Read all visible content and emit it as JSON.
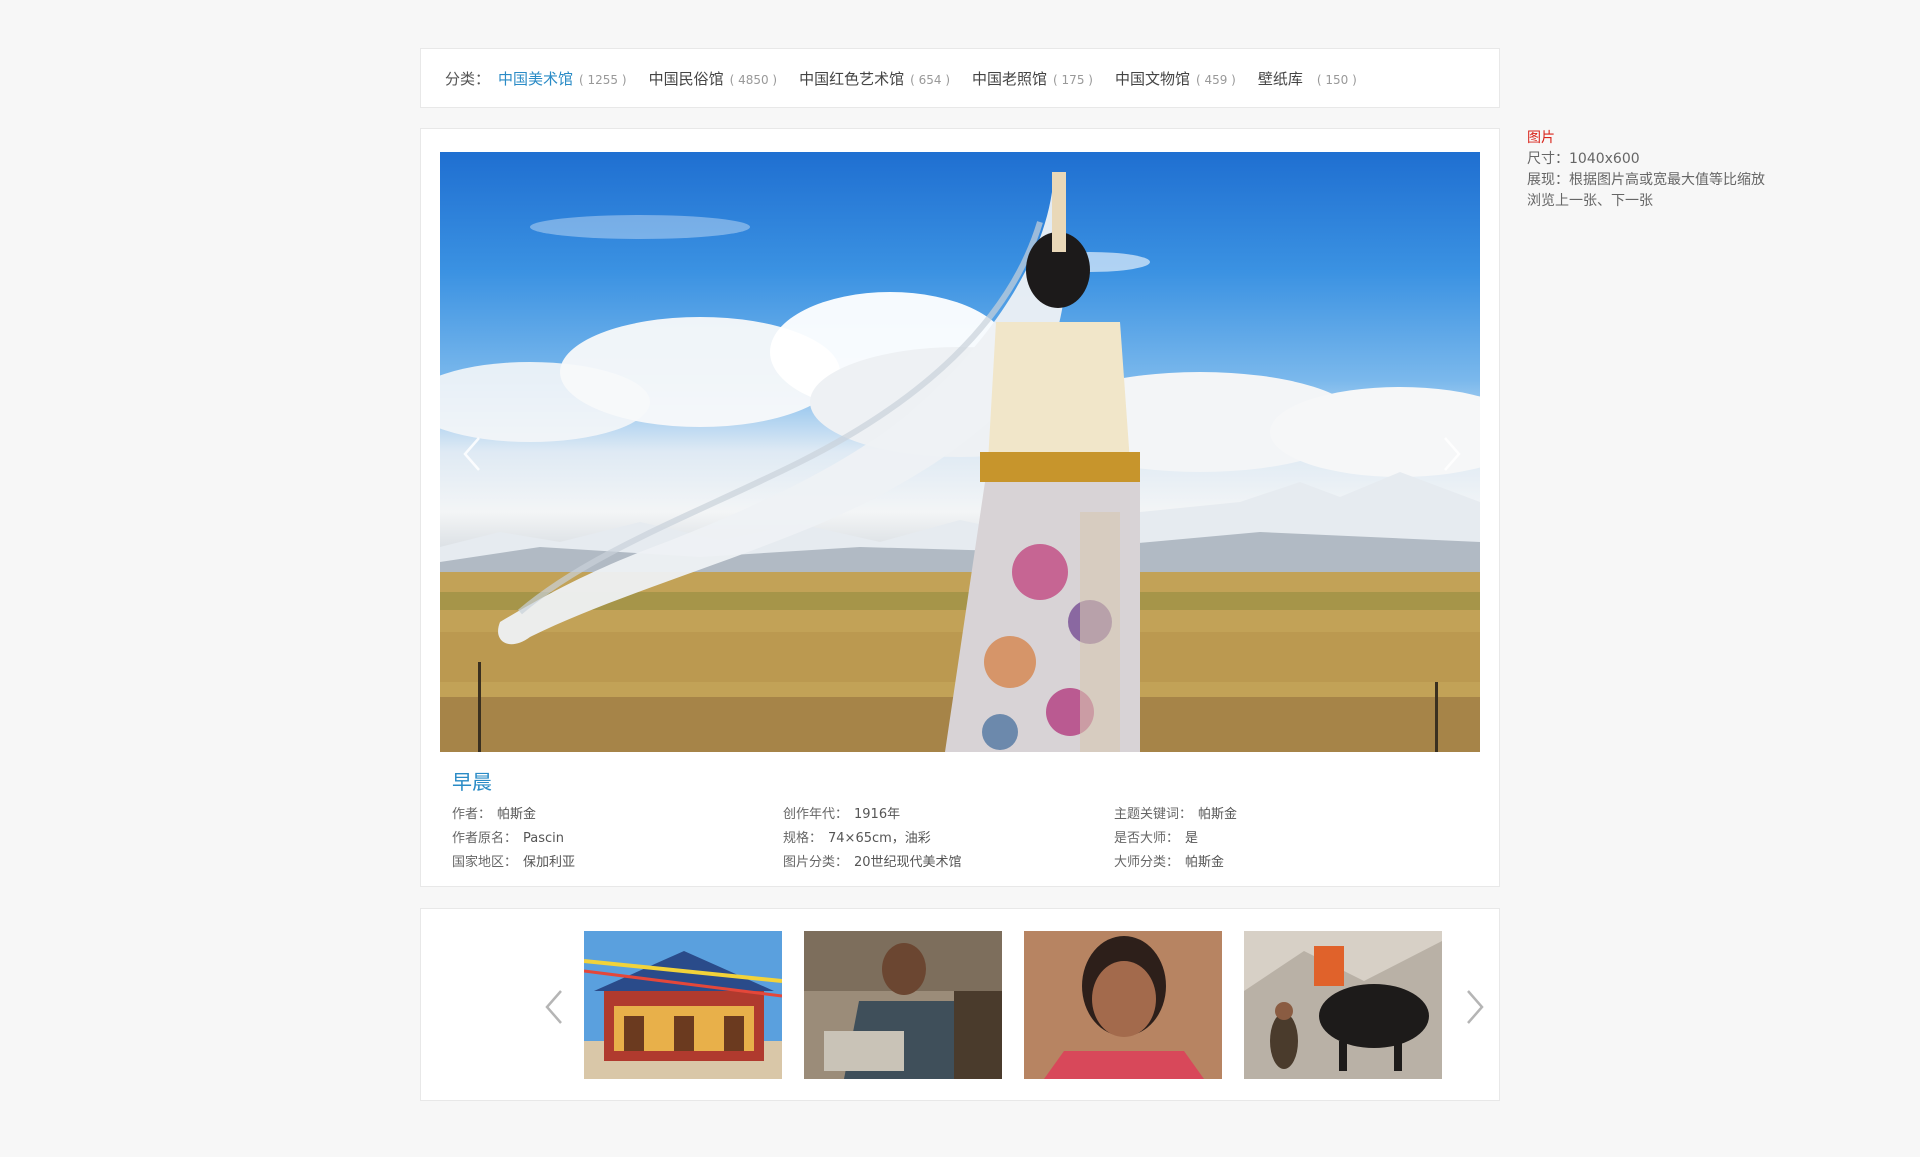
{
  "categories": {
    "label": "分类：",
    "items": [
      {
        "name": "中国美术馆",
        "count": "( 1255 )",
        "active": true
      },
      {
        "name": "中国民俗馆",
        "count": "( 4850 )"
      },
      {
        "name": "中国红色艺术馆",
        "count": "( 654 )"
      },
      {
        "name": "中国老照馆",
        "count": "( 175 )"
      },
      {
        "name": "中国文物馆",
        "count": "( 459 )"
      },
      {
        "name": "壁纸库",
        "count": "( 150 )"
      }
    ]
  },
  "artwork": {
    "title": "早晨",
    "meta": {
      "author_label": "作者：",
      "author": "帕斯金",
      "year_label": "创作年代：",
      "year": "1916年",
      "keyword_label": "主题关键词：",
      "keyword": "帕斯金",
      "original_name_label": "作者原名：",
      "original_name": "Pascin",
      "spec_label": "规格：",
      "spec": "74×65cm，油彩",
      "master_label": "是否大师：",
      "master": "是",
      "country_label": "国家地区：",
      "country": "保加利亚",
      "category_label": "图片分类：",
      "category": "20世纪现代美术馆",
      "master_category_label": "大师分类：",
      "master_category": "帕斯金"
    }
  },
  "icons": {
    "prev": "chevron-left-icon",
    "next": "chevron-right-icon"
  },
  "notes": {
    "title": "图片",
    "lines": [
      "尺寸：1040x600",
      "展现：根据图片高或宽最大值等比缩放",
      "浏览上一张、下一张"
    ]
  },
  "colors": {
    "accent": "#2a8bc6",
    "note_title": "#d9261c"
  }
}
